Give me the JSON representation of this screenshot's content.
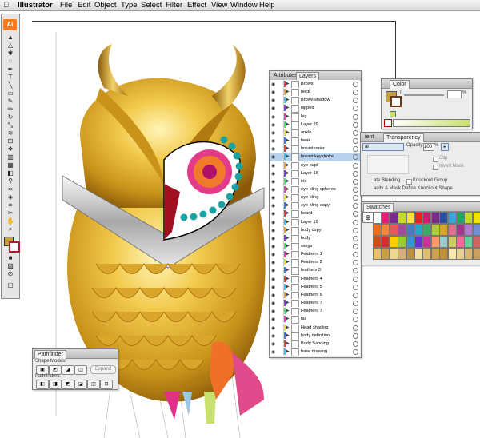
{
  "menubar": {
    "apple": "",
    "app": "Illustrator",
    "items": [
      "File",
      "Edit",
      "Object",
      "Type",
      "Select",
      "Filter",
      "Effect",
      "View",
      "Window",
      "Help"
    ]
  },
  "toolbox": {
    "logo": "Ai"
  },
  "layers_panel": {
    "tabs": [
      "Attributes",
      "Layers"
    ],
    "active_tab": "Layers",
    "rows": [
      {
        "name": "Brows",
        "color": "#e83e3e"
      },
      {
        "name": "neck",
        "color": "#e8a23e"
      },
      {
        "name": "Brows shadow",
        "color": "#3ec0e8"
      },
      {
        "name": "flipped",
        "color": "#7d3ee8"
      },
      {
        "name": "leg",
        "color": "#e83eb2"
      },
      {
        "name": "Layer 29",
        "color": "#3ee86a"
      },
      {
        "name": "ankle",
        "color": "#e8e03e"
      },
      {
        "name": "beak",
        "color": "#3e7be8"
      },
      {
        "name": "breast outer",
        "color": "#e83e3e"
      },
      {
        "name": "breast keystroke",
        "color": "#3ec0e8"
      },
      {
        "name": "eye pupil",
        "color": "#e8a23e"
      },
      {
        "name": "Layer 16",
        "color": "#7d3ee8"
      },
      {
        "name": "iris",
        "color": "#3ee86a"
      },
      {
        "name": "eye bling spheres",
        "color": "#e83eb2"
      },
      {
        "name": "eye bling",
        "color": "#e8e03e"
      },
      {
        "name": "eye bling copy",
        "color": "#3e7be8"
      },
      {
        "name": "beard",
        "color": "#e83e3e"
      },
      {
        "name": "Layer 19",
        "color": "#3ec0e8"
      },
      {
        "name": "body copy",
        "color": "#e8a23e"
      },
      {
        "name": "body",
        "color": "#7d3ee8"
      },
      {
        "name": "wings",
        "color": "#3ee86a"
      },
      {
        "name": "Feathers 1",
        "color": "#e83eb2"
      },
      {
        "name": "Feathers 2",
        "color": "#e8e03e"
      },
      {
        "name": "feathers 3",
        "color": "#3e7be8"
      },
      {
        "name": "Feathers 4",
        "color": "#e83e3e"
      },
      {
        "name": "Feathers 5",
        "color": "#3ec0e8"
      },
      {
        "name": "Feathers 6",
        "color": "#e8a23e"
      },
      {
        "name": "Feathers 7",
        "color": "#7d3ee8"
      },
      {
        "name": "Feathers 7",
        "color": "#3ee86a"
      },
      {
        "name": "tail",
        "color": "#e83eb2"
      },
      {
        "name": "Head shading",
        "color": "#e8e03e"
      },
      {
        "name": "body definition",
        "color": "#3e7be8"
      },
      {
        "name": "Body Sahding",
        "color": "#e83e3e"
      },
      {
        "name": "base drawing",
        "color": "#3ec0e8"
      }
    ],
    "selected_index": 9
  },
  "color_panel": {
    "tab": "Color",
    "channel": "T",
    "value": "",
    "unit": "%"
  },
  "transparency_panel": {
    "tabs": [
      "ient",
      "Transparency"
    ],
    "active_tab": "Transparency",
    "mode": "al",
    "opacity_label": "Opacity:",
    "opacity_value": "100",
    "opacity_unit": "%",
    "clip_label": "Clip",
    "invert_label": "Invert Mask",
    "isolate_label": "ate Blending",
    "knockout_label": "Knockout Group",
    "footer": "acity & Mask Define Knockout Shape"
  },
  "swatches_panel": {
    "tab": "Swatches",
    "colors": [
      "#ffffff",
      "#e01f7a",
      "#7b2a8e",
      "#c2d82a",
      "#f5e23a",
      "#e4231b",
      "#d31a6f",
      "#7b2a8e",
      "#2a4fa0",
      "#35a7da",
      "#1eaa54",
      "#c2d82a",
      "#f2e200",
      "#f26a1b",
      "#f0863a",
      "#e25b5b",
      "#a7479e",
      "#4a7bc2",
      "#2aa5c8",
      "#3aaa65",
      "#b0c93e",
      "#d9a32a",
      "#e26f8e",
      "#9b3b8c",
      "#b07acd",
      "#6f8fd0",
      "#d44a1b",
      "#cc3333",
      "#ffcc00",
      "#99cc33",
      "#3399cc",
      "#6633cc",
      "#cc3399",
      "#ff9966",
      "#99cccc",
      "#cccc66",
      "#ff6699",
      "#66cc99",
      "#cc6666",
      "#e8c36a",
      "#c8a04a",
      "#f0d890",
      "#d8b070",
      "#b8904a",
      "#f0e0a0",
      "#e0c070",
      "#d0a050",
      "#c09040",
      "#f8e8b0",
      "#e8d090",
      "#d8b870",
      "#c8a060"
    ]
  },
  "pathfinder_panel": {
    "tab": "Pathfinder",
    "shape_modes_label": "Shape Modes:",
    "pathfinders_label": "Pathfinders:",
    "expand_label": "Expand"
  }
}
